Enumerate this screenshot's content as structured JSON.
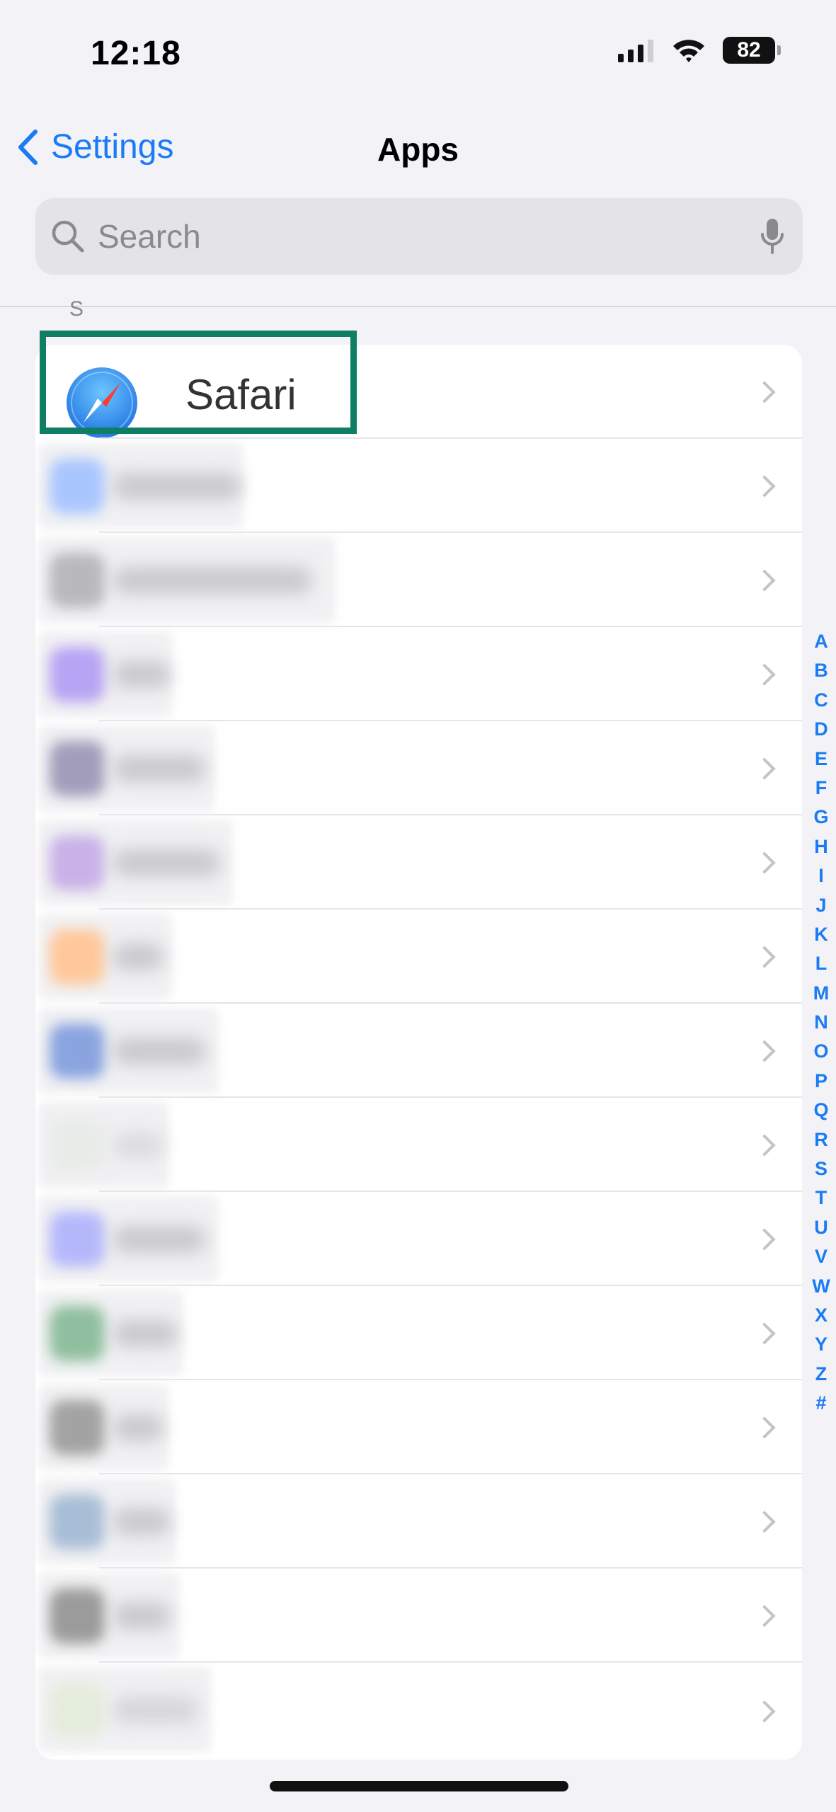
{
  "status_bar": {
    "time": "12:18",
    "battery": "82",
    "icons": [
      "cellular-signal-icon",
      "wifi-icon",
      "battery-icon"
    ]
  },
  "nav": {
    "back_label": "Settings",
    "back_icon": "chevron-left-icon",
    "title": "Apps"
  },
  "search": {
    "placeholder": "Search",
    "icon": "magnifying-glass-icon",
    "mic_icon": "microphone-icon"
  },
  "list": {
    "section_letter": "S",
    "highlighted_item": "Safari",
    "items": [
      {
        "label": "Safari",
        "icon": "safari-compass-icon"
      },
      {
        "label": "",
        "icon": "blurred-app-icon",
        "color": "#a9c6ff"
      },
      {
        "label": "",
        "icon": "blurred-app-icon",
        "color": "#b9b9bd"
      },
      {
        "label": "",
        "icon": "blurred-app-icon",
        "color": "#b7a4f4"
      },
      {
        "label": "",
        "icon": "blurred-app-icon",
        "color": "#a29dbb"
      },
      {
        "label": "",
        "icon": "blurred-app-icon",
        "color": "#c9b2e7"
      },
      {
        "label": "",
        "icon": "blurred-app-icon",
        "color": "#ffc79a"
      },
      {
        "label": "",
        "icon": "blurred-app-icon",
        "color": "#8aa4e0"
      },
      {
        "label": "",
        "icon": "blurred-app-icon",
        "color": "#e9ebe9"
      },
      {
        "label": "",
        "icon": "blurred-app-icon",
        "color": "#b4b8fb"
      },
      {
        "label": "",
        "icon": "blurred-app-icon",
        "color": "#8fbf9e"
      },
      {
        "label": "",
        "icon": "blurred-app-icon",
        "color": "#a3a3a3"
      },
      {
        "label": "",
        "icon": "blurred-app-icon",
        "color": "#a8bed6"
      },
      {
        "label": "",
        "icon": "blurred-app-icon",
        "color": "#9b9b9b"
      },
      {
        "label": "",
        "icon": "blurred-app-icon",
        "color": "#e4ecdc"
      }
    ]
  },
  "index_letters": [
    "A",
    "B",
    "C",
    "D",
    "E",
    "F",
    "G",
    "H",
    "I",
    "J",
    "K",
    "L",
    "M",
    "N",
    "O",
    "P",
    "Q",
    "R",
    "S",
    "T",
    "U",
    "V",
    "W",
    "X",
    "Y",
    "Z",
    "#"
  ],
  "colors": {
    "accent": "#1a7cf5",
    "highlight_border": "#0e7e64",
    "background": "#f2f2f7"
  }
}
